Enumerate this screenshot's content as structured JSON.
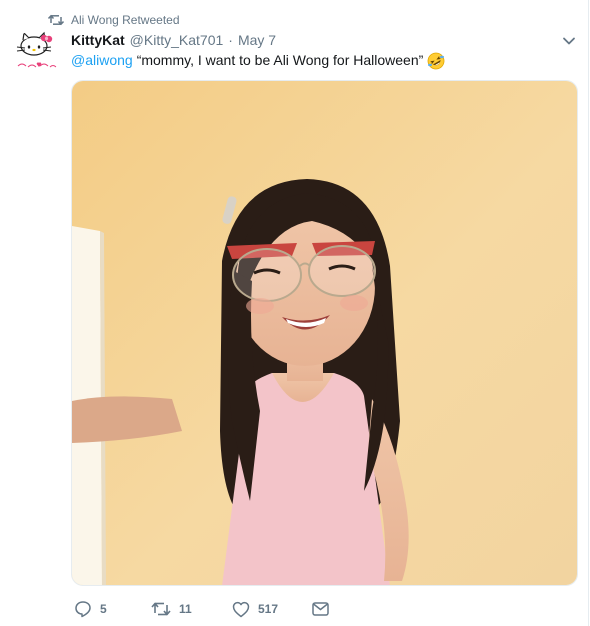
{
  "retweet_context": {
    "text": "Ali Wong Retweeted"
  },
  "tweet": {
    "display_name": "KittyKat",
    "handle": "@Kitty_Kat701",
    "separator": "·",
    "date": "May 7",
    "mention": "@aliwong",
    "text": "“mommy, I want to be Ali Wong for Halloween”",
    "emoji": "rolling-on-floor-laughing-emoji"
  },
  "actions": {
    "replies": "5",
    "retweets": "11",
    "likes": "517"
  },
  "colors": {
    "accent": "#1da1f2",
    "secondary_text": "#657786",
    "primary_text": "#14171a"
  }
}
